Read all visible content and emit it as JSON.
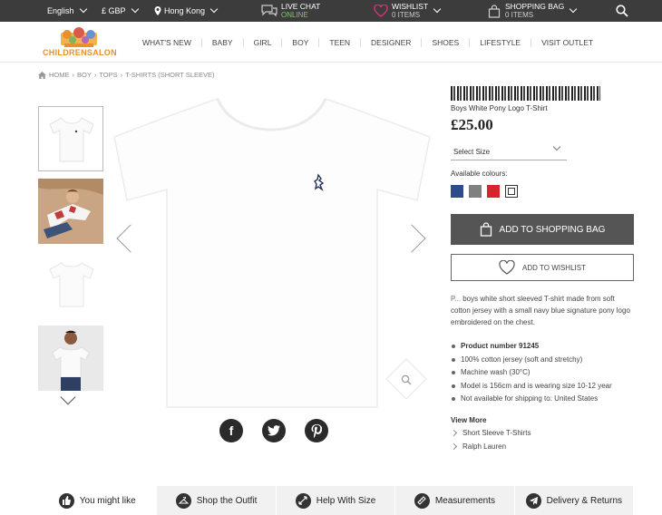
{
  "topbar": {
    "language": "English",
    "currency": "£ GBP",
    "location": "Hong Kong",
    "live_chat": {
      "label": "LIVE CHAT",
      "status": "ONLINE"
    },
    "wishlist": {
      "label": "WISHLIST",
      "count": "0 ITEMS"
    },
    "bag": {
      "label": "SHOPPING BAG",
      "count": "0 ITEMS"
    }
  },
  "logo": {
    "text": "CHILDRENSALON"
  },
  "nav": [
    "WHAT'S NEW",
    "BABY",
    "GIRL",
    "BOY",
    "TEEN",
    "DESIGNER",
    "SHOES",
    "LIFESTYLE",
    "VISIT OUTLET"
  ],
  "breadcrumb": [
    "HOME",
    "BOY",
    "TOPS",
    "T-SHIRTS (SHORT SLEEVE)"
  ],
  "product": {
    "title": "Boys White Pony Logo T-Shirt",
    "price": "£25.00",
    "size_placeholder": "Select Size",
    "colours_label": "Available colours:",
    "swatches": [
      "#2d4a8a",
      "#808080",
      "#d7262b",
      "#ffffff"
    ],
    "add_to_bag": "ADD TO SHOPPING BAG",
    "add_to_wishlist": "ADD TO WISHLIST",
    "description": "boys white short sleeved T-shirt made from soft cotton jersey with a small navy blue signature pony logo embroidered on the chest.",
    "description_prefix": "P...",
    "details": [
      "Product number 91245",
      "100% cotton jersey (soft and stretchy)",
      "Machine wash (30°C)",
      "Model is 156cm and is wearing size 10-12 year",
      "Not available for shipping to: United States"
    ],
    "view_more": "View More",
    "view_more_links": [
      "Short Sleeve T-Shirts",
      "Ralph Lauren"
    ]
  },
  "social": [
    "f",
    "t",
    "p"
  ],
  "tabs": [
    "You might like",
    "Shop the Outfit",
    "Help With Size",
    "Measurements",
    "Delivery & Returns"
  ]
}
